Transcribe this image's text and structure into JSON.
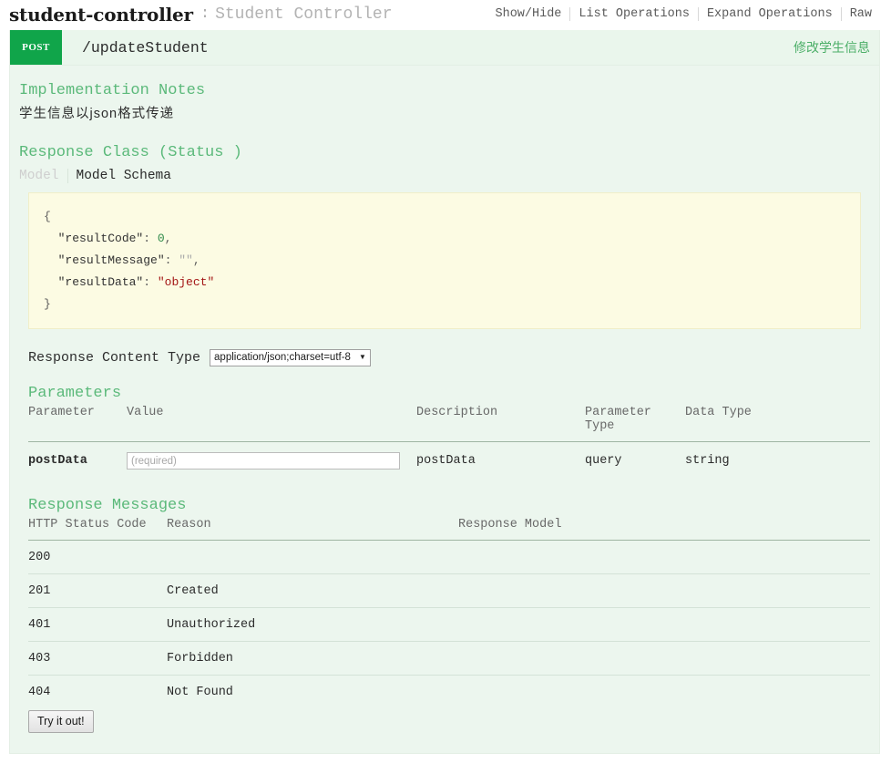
{
  "resource": {
    "name": "student-controller",
    "separator": ":",
    "description": "Student Controller",
    "options": [
      {
        "label": "Show/Hide"
      },
      {
        "label": "List Operations"
      },
      {
        "label": "Expand Operations"
      },
      {
        "label": "Raw"
      }
    ]
  },
  "operation": {
    "method": "POST",
    "path": "/updateStudent",
    "summary": "修改学生信息",
    "implementation_notes_title": "Implementation Notes",
    "implementation_notes": "学生信息以json格式传递",
    "response_class_title": "Response Class (Status )",
    "model_tabs": [
      {
        "label": "Model",
        "active": false
      },
      {
        "label": "Model Schema",
        "active": true
      }
    ],
    "model_schema": {
      "open_brace": "{",
      "close_brace": "}",
      "lines": [
        {
          "key": "\"resultCode\"",
          "value": "0",
          "type": "num",
          "comma": ","
        },
        {
          "key": "\"resultMessage\"",
          "value": "\"\"",
          "type": "empty",
          "comma": ","
        },
        {
          "key": "\"resultData\"",
          "value": "\"object\"",
          "type": "str",
          "comma": ""
        }
      ]
    },
    "response_content_type": {
      "label": "Response Content Type",
      "value": "application/json;charset=utf-8",
      "options": [
        "application/json;charset=utf-8"
      ]
    },
    "parameters_title": "Parameters",
    "parameters_headers": [
      "Parameter",
      "Value",
      "Description",
      "Parameter Type",
      "Data Type"
    ],
    "parameters_header_ptype_line1": "Parameter",
    "parameters_header_ptype_line2": "Type",
    "parameters": [
      {
        "name": "postData",
        "value": "",
        "placeholder": "(required)",
        "description": "postData",
        "param_type": "query",
        "data_type": "string"
      }
    ],
    "response_messages_title": "Response Messages",
    "response_headers": [
      "HTTP Status Code",
      "Reason",
      "Response Model"
    ],
    "response_messages": [
      {
        "code": "200",
        "reason": "",
        "model": ""
      },
      {
        "code": "201",
        "reason": "Created",
        "model": ""
      },
      {
        "code": "401",
        "reason": "Unauthorized",
        "model": ""
      },
      {
        "code": "403",
        "reason": "Forbidden",
        "model": ""
      },
      {
        "code": "404",
        "reason": "Not Found",
        "model": ""
      }
    ],
    "try_button": "Try it out!"
  },
  "colors": {
    "method_post": "#10a54a",
    "accent_green": "#5bb97a",
    "summary_green": "#4caf68",
    "panel_bg": "#ecf6ee",
    "code_bg": "#fcfbe3"
  }
}
